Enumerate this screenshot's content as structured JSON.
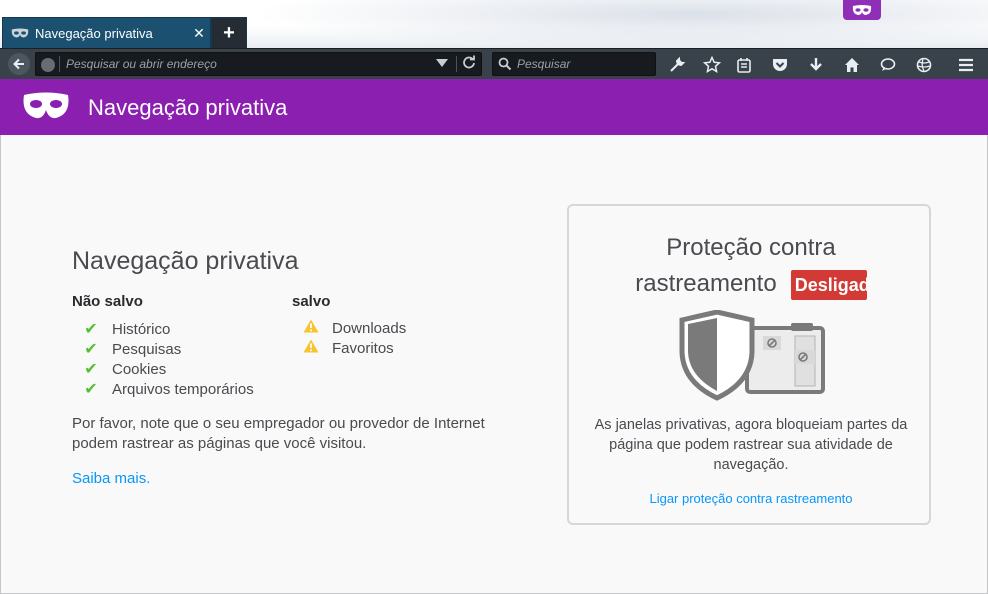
{
  "window": {
    "tab": {
      "title": "Navegação privativa",
      "close_glyph": "✕"
    },
    "new_tab_glyph": "+"
  },
  "navbar": {
    "url_placeholder": "Pesquisar ou abrir endereço",
    "search_placeholder": "Pesquisar",
    "icons": [
      "back-icon",
      "reload-icon",
      "wrench-icon",
      "star-icon",
      "reading-list-icon",
      "pocket-icon",
      "download-icon",
      "home-icon",
      "chat-icon",
      "globe-icon",
      "menu-icon"
    ]
  },
  "header": {
    "title": "Navegação privativa",
    "color": "#8b1fb0"
  },
  "main": {
    "title": "Navegação privativa",
    "not_saved": {
      "heading": "Não salvo",
      "items": [
        "Histórico",
        "Pesquisas",
        "Cookies",
        "Arquivos temporários"
      ]
    },
    "saved": {
      "heading": "salvo",
      "items": [
        "Downloads",
        "Favoritos"
      ]
    },
    "notice": "Por favor, note que o seu empregador ou provedor de Internet podem rastrear as páginas que você visitou.",
    "learn_more": "Saiba mais."
  },
  "tracking": {
    "title_line1": "Proteção contra",
    "title_line2": "rastreamento",
    "badge": "Desligado",
    "badge_color": "#d33a36",
    "description": "As janelas privativas, agora bloqueiam partes da página que podem rastrear sua atividade de navegação.",
    "link": "Ligar proteção contra rastreamento"
  },
  "colors": {
    "accent_purple": "#8b1fb0",
    "link_blue": "#0996f8",
    "check_green": "#57bd35",
    "warn_yellow": "#f7c430"
  }
}
